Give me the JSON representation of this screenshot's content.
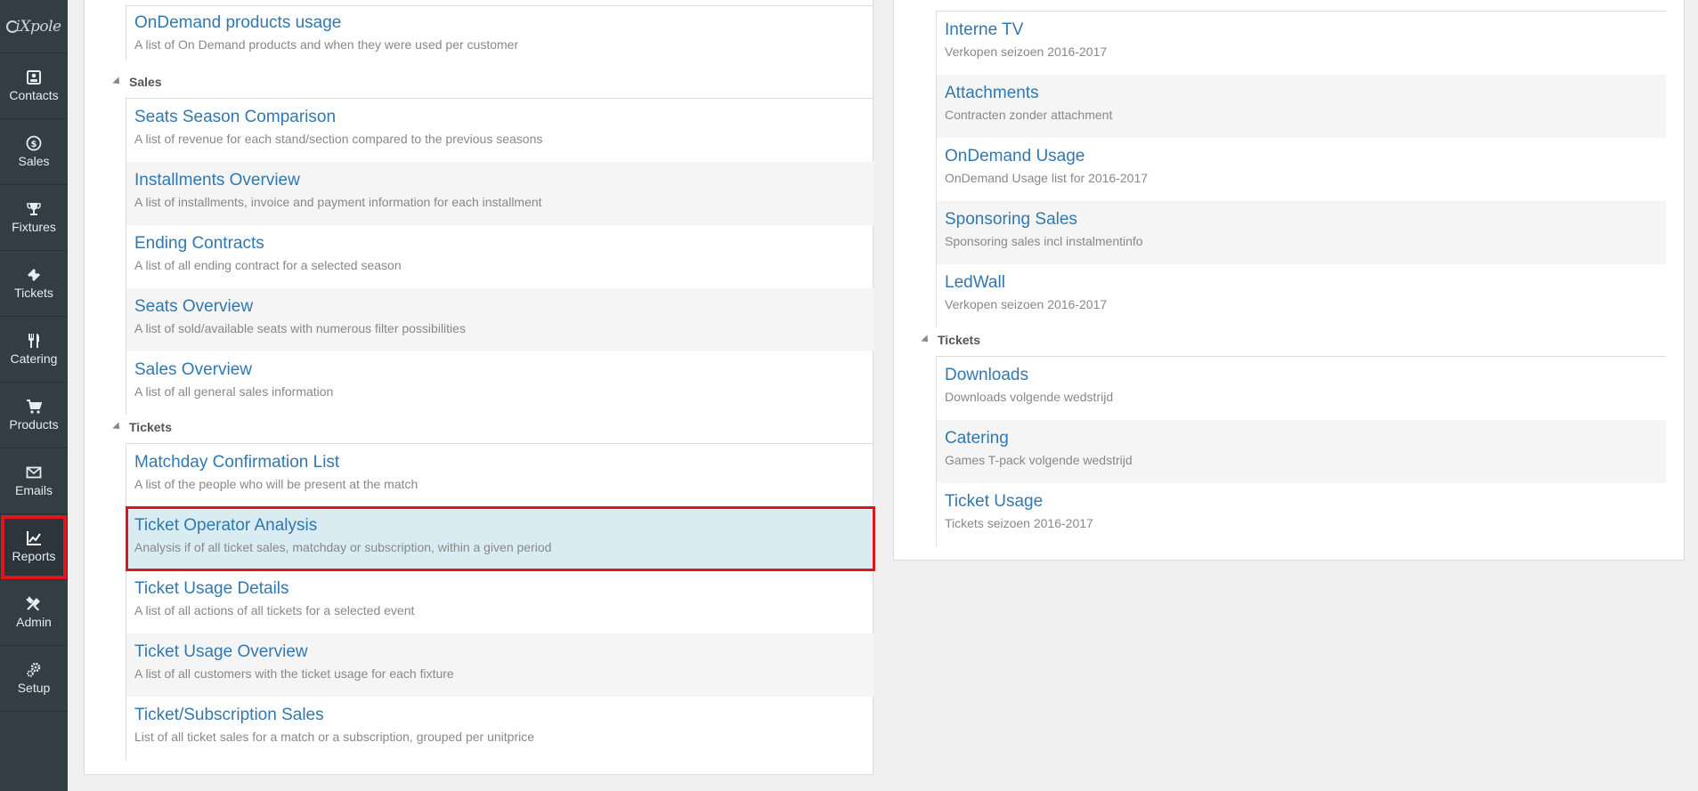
{
  "sidebar": {
    "logo": "iXpole",
    "items": [
      {
        "label": "Contacts",
        "icon": "contacts-icon"
      },
      {
        "label": "Sales",
        "icon": "dollar-icon"
      },
      {
        "label": "Fixtures",
        "icon": "trophy-icon"
      },
      {
        "label": "Tickets",
        "icon": "ticket-icon"
      },
      {
        "label": "Catering",
        "icon": "cutlery-icon"
      },
      {
        "label": "Products",
        "icon": "cart-icon"
      },
      {
        "label": "Emails",
        "icon": "envelope-icon"
      },
      {
        "label": "Reports",
        "icon": "chart-icon"
      },
      {
        "label": "Admin",
        "icon": "tools-icon"
      },
      {
        "label": "Setup",
        "icon": "gears-icon"
      }
    ]
  },
  "left": {
    "top_item": {
      "title": "OnDemand products usage",
      "desc": "A list of On Demand products and when they were used per customer"
    },
    "sales": {
      "heading": "Sales",
      "items": [
        {
          "title": "Seats Season Comparison",
          "desc": "A list of revenue for each stand/section compared to the previous seasons"
        },
        {
          "title": "Installments Overview",
          "desc": "A list of installments, invoice and payment information for each installment"
        },
        {
          "title": "Ending Contracts",
          "desc": "A list of all ending contract for a selected season"
        },
        {
          "title": "Seats Overview",
          "desc": "A list of sold/available seats with numerous filter possibilities"
        },
        {
          "title": "Sales Overview",
          "desc": "A list of all general sales information"
        }
      ]
    },
    "tickets": {
      "heading": "Tickets",
      "items": [
        {
          "title": "Matchday Confirmation List",
          "desc": "A list of the people who will be present at the match"
        },
        {
          "title": "Ticket Operator Analysis",
          "desc": "Analysis if of all ticket sales, matchday or subscription, within a given period"
        },
        {
          "title": "Ticket Usage Details",
          "desc": "A list of all actions of all tickets for a selected event"
        },
        {
          "title": "Ticket Usage Overview",
          "desc": "A list of all customers with the ticket usage for each fixture"
        },
        {
          "title": "Ticket/Subscription Sales",
          "desc": "List of all ticket sales for a match or a subscription, grouped per unitprice"
        }
      ]
    }
  },
  "right": {
    "top_items": [
      {
        "title": "Interne TV",
        "desc": "Verkopen seizoen 2016-2017"
      },
      {
        "title": "Attachments",
        "desc": "Contracten zonder attachment"
      },
      {
        "title": "OnDemand Usage",
        "desc": "OnDemand Usage list for 2016-2017"
      },
      {
        "title": "Sponsoring Sales",
        "desc": "Sponsoring sales incl instalmentinfo"
      },
      {
        "title": "LedWall",
        "desc": "Verkopen seizoen 2016-2017"
      }
    ],
    "tickets": {
      "heading": "Tickets",
      "items": [
        {
          "title": "Downloads",
          "desc": "Downloads volgende wedstrijd"
        },
        {
          "title": "Catering",
          "desc": "Games T-pack volgende wedstrijd"
        },
        {
          "title": "Ticket Usage",
          "desc": "Tickets seizoen 2016-2017"
        }
      ]
    }
  },
  "colors": {
    "accent": "#3178b0",
    "highlight": "#d9ecf1",
    "marker": "#e0161d",
    "sidebar": "#323d44"
  }
}
